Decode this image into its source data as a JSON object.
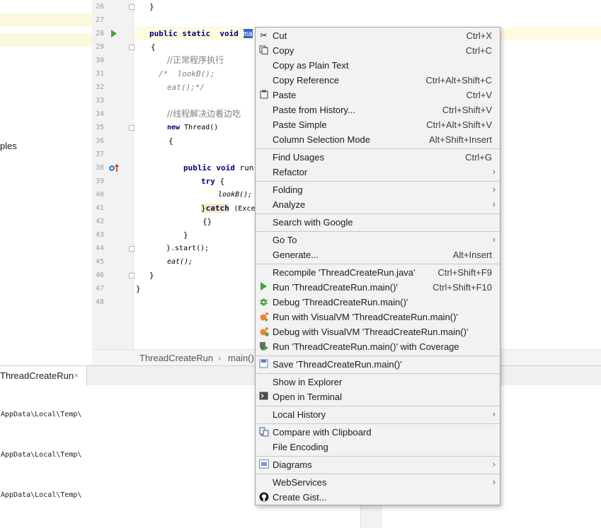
{
  "project": {
    "truncated_label": "ples"
  },
  "editor": {
    "line_numbers": [
      "26",
      "27",
      "28",
      "29",
      "30",
      "31",
      "32",
      "33",
      "34",
      "35",
      "36",
      "37",
      "38",
      "39",
      "40",
      "41",
      "42",
      "43",
      "44",
      "45",
      "46",
      "47",
      "48"
    ],
    "lines": {
      "l26": "}",
      "l28_kw1": "public",
      "l28_kw2": "static",
      "l28_kw3": "void",
      "l28_sel": "ma",
      "l29": "{",
      "l30": "//正常程序执行",
      "l31": "/*  lookB();",
      "l32": "eat();*/",
      "l34": "//线程解决边看边吃",
      "l35_kw": "new",
      "l35_rest": "Thread()",
      "l36": "{",
      "l38_kw1": "public",
      "l38_kw2": "void",
      "l38_rest": "run",
      "l39_kw": "try",
      "l39_rest": "{",
      "l40": "lookB();",
      "l41_brace": "}",
      "l41_kw": "catch",
      "l41_rest": "(Exce",
      "l42": "{}",
      "l43": "}",
      "l44": "}.start();",
      "l45": "eat();",
      "l46": "}",
      "l47": "}"
    }
  },
  "breadcrumb": {
    "class_name": "ThreadCreateRun",
    "separator": "›",
    "method": "main()"
  },
  "run_panel": {
    "tab_label": "ThreadCreateRun",
    "tab_close": "×",
    "lines": [
      "AppData\\Local\\Temp\\",
      "AppData\\Local\\Temp\\",
      "AppData\\Local\\Temp\\"
    ]
  },
  "menu": {
    "items": [
      {
        "label": "Cut",
        "shortcut": "Ctrl+X",
        "icon": "scissors-icon"
      },
      {
        "label": "Copy",
        "shortcut": "Ctrl+C",
        "icon": "copy-icon"
      },
      {
        "label": "Copy as Plain Text",
        "shortcut": ""
      },
      {
        "label": "Copy Reference",
        "shortcut": "Ctrl+Alt+Shift+C"
      },
      {
        "label": "Paste",
        "shortcut": "Ctrl+V",
        "icon": "clipboard-icon"
      },
      {
        "label": "Paste from History...",
        "shortcut": "Ctrl+Shift+V"
      },
      {
        "label": "Paste Simple",
        "shortcut": "Ctrl+Alt+Shift+V"
      },
      {
        "label": "Column Selection Mode",
        "shortcut": "Alt+Shift+Insert"
      },
      {
        "label": "Find Usages",
        "shortcut": "Ctrl+G"
      },
      {
        "label": "Refactor",
        "submenu": true
      },
      {
        "label": "Folding",
        "submenu": true
      },
      {
        "label": "Analyze",
        "submenu": true
      },
      {
        "label": "Search with Google",
        "shortcut": ""
      },
      {
        "label": "Go To",
        "submenu": true
      },
      {
        "label": "Generate...",
        "shortcut": "Alt+Insert"
      },
      {
        "label": "Recompile 'ThreadCreateRun.java'",
        "shortcut": "Ctrl+Shift+F9"
      },
      {
        "label": "Run 'ThreadCreateRun.main()'",
        "shortcut": "Ctrl+Shift+F10",
        "icon": "run-icon"
      },
      {
        "label": "Debug 'ThreadCreateRun.main()'",
        "shortcut": "",
        "icon": "debug-icon"
      },
      {
        "label": "Run with VisualVM 'ThreadCreateRun.main()'",
        "shortcut": "",
        "icon": "visualvm-run-icon"
      },
      {
        "label": "Debug with VisualVM 'ThreadCreateRun.main()'",
        "shortcut": "",
        "icon": "visualvm-debug-icon"
      },
      {
        "label": "Run 'ThreadCreateRun.main()' with Coverage",
        "shortcut": "",
        "icon": "coverage-icon"
      },
      {
        "label": "Save 'ThreadCreateRun.main()'",
        "shortcut": "",
        "icon": "save-icon"
      },
      {
        "label": "Show in Explorer",
        "shortcut": ""
      },
      {
        "label": "Open in Terminal",
        "shortcut": "",
        "icon": "terminal-icon"
      },
      {
        "label": "Local History",
        "submenu": true
      },
      {
        "label": "Compare with Clipboard",
        "shortcut": "",
        "icon": "compare-icon"
      },
      {
        "label": "File Encoding",
        "shortcut": ""
      },
      {
        "label": "Diagrams",
        "submenu": true,
        "icon": "diagram-icon"
      },
      {
        "label": "WebServices",
        "submenu": true
      },
      {
        "label": "Create Gist...",
        "shortcut": "",
        "icon": "github-icon"
      }
    ],
    "arrow": "›"
  },
  "colors": {
    "selection": "#2f65ca",
    "keyword": "#000080",
    "comment": "#808080",
    "run_green": "#3aa63a",
    "menu_bg": "#f2f2f2"
  }
}
